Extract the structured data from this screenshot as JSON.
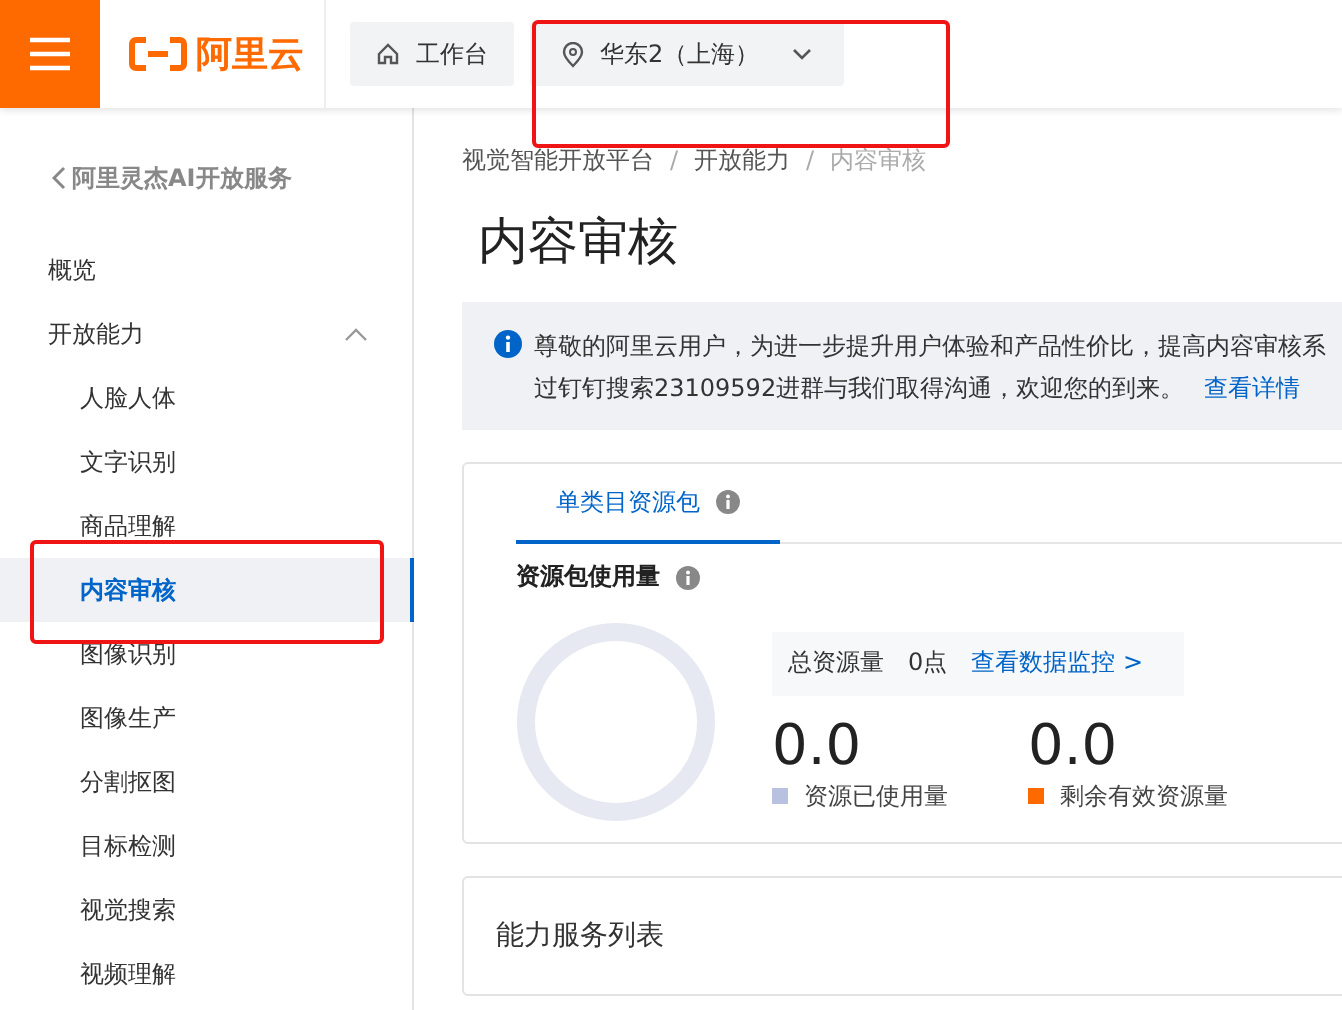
{
  "header": {
    "brand": "阿里云",
    "workbench": "工作台",
    "region": "华东2（上海）"
  },
  "sidebar": {
    "back_link": "阿里灵杰AI开放服务",
    "items": [
      {
        "label": "概览",
        "selected": false
      },
      {
        "label": "开放能力",
        "selected": false,
        "expanded": true,
        "children": [
          {
            "label": "人脸人体",
            "selected": false
          },
          {
            "label": "文字识别",
            "selected": false
          },
          {
            "label": "商品理解",
            "selected": false
          },
          {
            "label": "内容审核",
            "selected": true
          },
          {
            "label": "图像识别",
            "selected": false
          },
          {
            "label": "图像生产",
            "selected": false
          },
          {
            "label": "分割抠图",
            "selected": false
          },
          {
            "label": "目标检测",
            "selected": false
          },
          {
            "label": "视觉搜索",
            "selected": false
          },
          {
            "label": "视频理解",
            "selected": false
          }
        ]
      }
    ]
  },
  "breadcrumb": {
    "separator": "/",
    "items": [
      "视觉智能开放平台",
      "开放能力",
      "内容审核"
    ]
  },
  "page_title": "内容审核",
  "notice": {
    "lines": [
      "尊敬的阿里云用户，为进一步提升用户体验和产品性价比，提高内容审核系",
      "过钉钉搜索23109592进群与我们取得沟通，欢迎您的到来。"
    ],
    "link": "查看详情"
  },
  "resource_card": {
    "tabs": [
      {
        "label": "单类目资源包",
        "selected": true
      }
    ],
    "section_title": "资源包使用量",
    "total_label": "总资源量",
    "total_value": "0点",
    "monitor_link": "查看数据监控 >",
    "stats": [
      {
        "value": "0.0",
        "label": "资源已使用量",
        "color": "#b8c1e0"
      },
      {
        "value": "0.0",
        "label": "剩余有效资源量",
        "color": "#ff6a00"
      }
    ]
  },
  "service_card": {
    "title": "能力服务列表"
  }
}
